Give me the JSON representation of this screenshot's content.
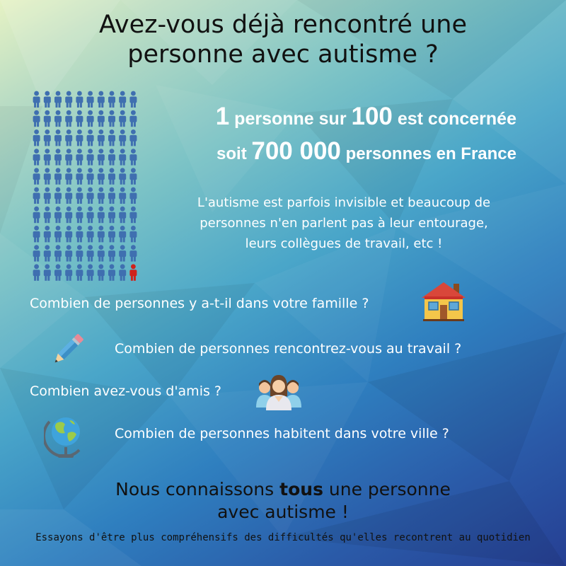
{
  "title": {
    "line1": "Avez-vous déjà rencontré une",
    "line2": "personne avec autisme ?"
  },
  "stat": {
    "line1_num1": "1",
    "line1_text1": " personne sur ",
    "line1_num2": "100",
    "line1_text2": " est concernée",
    "line2_text1": "soit ",
    "line2_num": "700 000",
    "line2_text2": " personnes en France"
  },
  "paragraph": {
    "line1": "L'autisme est parfois invisible et beaucoup de",
    "line2": "personnes n'en parlent pas à leur entourage,",
    "line3": "leurs collègues de travail, etc !"
  },
  "questions": {
    "famille": "Combien de personnes y a-t-il dans votre famille ?",
    "travail": "Combien de personnes rencontrez-vous au travail ?",
    "amis": "Combien avez-vous d'amis ?",
    "ville": "Combien de personnes habitent dans votre ville ?"
  },
  "conclusion": {
    "part1": "Nous connaissons ",
    "bold": "tous",
    "part2": " une personne",
    "line2": "avec autisme !"
  },
  "footer": "Essayons d'être plus compréhensifs des difficultés qu'elles recontrent au quotidien",
  "pictogram": {
    "total": 100,
    "highlighted": 1,
    "color_normal": "#3f6fb0",
    "color_highlight": "#d0221c"
  },
  "icons": [
    "people-grid-icon",
    "house-icon",
    "pencil-icon",
    "group-of-friends-icon",
    "globe-icon"
  ]
}
